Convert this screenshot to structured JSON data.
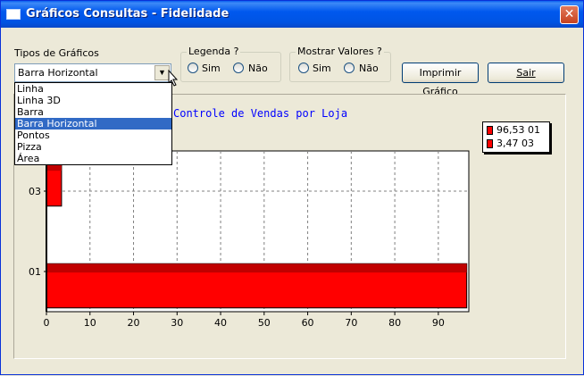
{
  "window": {
    "title": "Gráficos Consultas - Fidelidade",
    "close_glyph": "✕"
  },
  "chart_type": {
    "label": "Tipos de Gráficos",
    "selected": "Barra Horizontal",
    "options": [
      "Linha",
      "Linha 3D",
      "Barra",
      "Barra Horizontal",
      "Pontos",
      "Pizza",
      "Área"
    ]
  },
  "legenda": {
    "label": "Legenda ?",
    "options": [
      "Sim",
      "Não"
    ]
  },
  "mostrar_valores": {
    "label": "Mostrar Valores ?",
    "options": [
      "Sim",
      "Não"
    ]
  },
  "buttons": {
    "print": "Imprimir Gráfico",
    "exit": "Sair"
  },
  "colors": {
    "bar": "#ff0000",
    "bar_dark": "#c00000",
    "title": "#0000ff"
  },
  "chart_data": {
    "type": "bar",
    "orientation": "horizontal",
    "title": "Controle de Vendas por Loja",
    "categories": [
      "01",
      "03"
    ],
    "values": [
      96.53,
      3.47
    ],
    "xlim": [
      0,
      97
    ],
    "xticks": [
      0,
      10,
      20,
      30,
      40,
      50,
      60,
      70,
      80,
      90
    ],
    "grid": true,
    "legend": [
      "96,53 01",
      "3,47 03"
    ],
    "legend_position": "top-right"
  }
}
